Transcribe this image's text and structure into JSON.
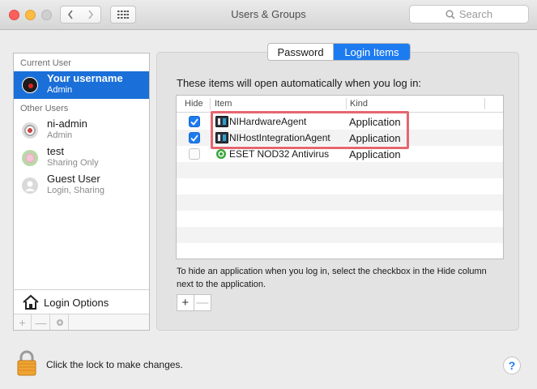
{
  "window": {
    "title": "Users & Groups",
    "search_placeholder": "Search"
  },
  "sidebar": {
    "current_user_label": "Current User",
    "current_user": {
      "name": "Your username",
      "role": "Admin"
    },
    "other_users_label": "Other Users",
    "other_users": [
      {
        "name": "ni-admin",
        "role": "Admin"
      },
      {
        "name": "test",
        "role": "Sharing Only"
      },
      {
        "name": "Guest User",
        "role": "Login, Sharing"
      }
    ],
    "login_options_label": "Login Options",
    "toolbar": {
      "add": "+",
      "remove": "—",
      "settings_icon": "gear-icon"
    }
  },
  "tabs": [
    {
      "label": "Password",
      "active": false
    },
    {
      "label": "Login Items",
      "active": true
    }
  ],
  "login_items": {
    "intro": "These items will open automatically when you log in:",
    "columns": [
      "Hide",
      "Item",
      "Kind"
    ],
    "rows": [
      {
        "hide": true,
        "item": "NIHardwareAgent",
        "kind": "Application",
        "icon": "ni-app-icon"
      },
      {
        "hide": true,
        "item": "NIHostIntegrationAgent",
        "kind": "Application",
        "icon": "ni-app-icon"
      },
      {
        "hide": false,
        "item": "ESET NOD32 Antivirus",
        "kind": "Application",
        "icon": "eset-icon"
      }
    ],
    "hint": "To hide an application when you log in, select the checkbox in the Hide column next to the application.",
    "add": "+",
    "remove": "—"
  },
  "footer": {
    "lock_text": "Click the lock to make changes.",
    "help": "?"
  },
  "colors": {
    "accent": "#1d7bf0",
    "selection": "#1a6fd8",
    "highlight_box": "#e56670"
  }
}
